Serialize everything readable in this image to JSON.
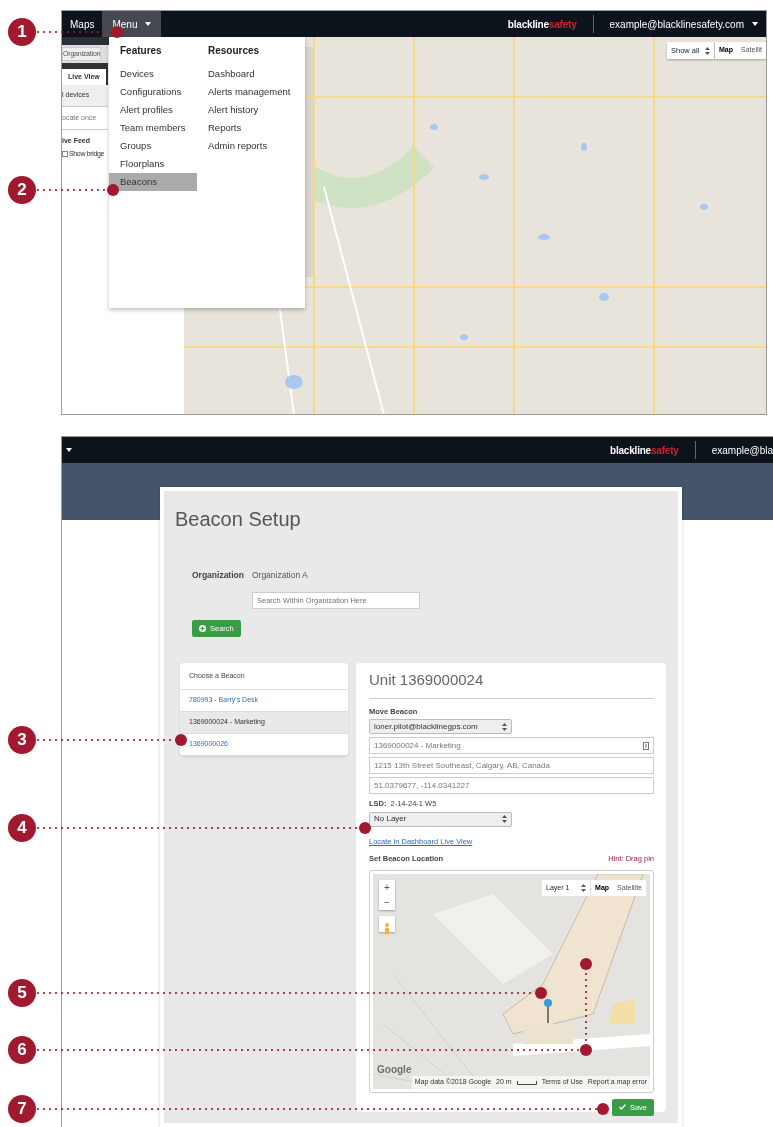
{
  "map_screen": {
    "navbar": {
      "maps_link": "Maps",
      "menu_button": "Menu",
      "logo_dark": "blackline",
      "logo_accent": "safety",
      "user_email": "example@blacklinesafety.com"
    },
    "side_panel": {
      "org_tab": "Organization",
      "tab": {
        "label": "Live View",
        "selected": true
      },
      "devices_row": "l devices",
      "locate_row": "ocate once",
      "feed_heading": "ive Feed",
      "bridge_option": {
        "label": "Show bridge",
        "checked": false
      }
    },
    "menu": {
      "columns": [
        {
          "heading": "Features",
          "items": [
            {
              "label": "Devices",
              "selected": false
            },
            {
              "label": "Configurations",
              "selected": false
            },
            {
              "label": "Alert profiles",
              "selected": false
            },
            {
              "label": "Team members",
              "selected": false
            },
            {
              "label": "Groups",
              "selected": false
            },
            {
              "label": "Floorplans",
              "selected": false
            },
            {
              "label": "Beacons",
              "selected": true
            }
          ]
        },
        {
          "heading": "Resources",
          "items": [
            {
              "label": "Dashboard",
              "selected": false
            },
            {
              "label": "Alerts management",
              "selected": false
            },
            {
              "label": "Alert history",
              "selected": false
            },
            {
              "label": "Reports",
              "selected": false
            },
            {
              "label": "Admin reports",
              "selected": false
            }
          ]
        }
      ]
    },
    "map_controls": {
      "filter_select": "Show all",
      "map_types": [
        {
          "label": "Map",
          "selected": true
        },
        {
          "label": "Satellit",
          "selected": false
        }
      ]
    }
  },
  "beacon_screen": {
    "navbar": {
      "logo_dark": "blackline",
      "logo_accent": "safety",
      "user_email": "example@bla"
    },
    "title": "Beacon Setup",
    "organization_label": "Organization",
    "organization_value": "Organization A",
    "search": {
      "placeholder": "Search Within Organization Here"
    },
    "search_button": "Search",
    "beacon_list": {
      "heading": "Choose a Beacon",
      "items": [
        {
          "label": "780993 - Barry's Desk",
          "selected": false
        },
        {
          "label": "1369000024 - Marketing",
          "selected": true
        },
        {
          "label": "1369000026",
          "selected": false
        }
      ]
    },
    "unit_title": "Unit 1369000024",
    "move_beacon_label": "Move Beacon",
    "owner_select": "loner.pilot@blacklinegps.com",
    "name_field": "1369000024 - Marketing",
    "address_field": "1215 13th Street Southeast, Calgary, AB, Canada",
    "coordinates_field": "51.0379677, -114.0341227",
    "lsd_label": "LSD:",
    "lsd_value": "2-14-24-1 W5",
    "layer_select": "No Layer",
    "locate_link": "Locate in Dashboard Live View",
    "set_location_label": "Set Beacon Location",
    "hint": "Hint: Drag pin",
    "map": {
      "zoom_in": "+",
      "zoom_out": "−",
      "layer_select": "Layer 1",
      "map_types": [
        {
          "label": "Map",
          "selected": true
        },
        {
          "label": "Satellite",
          "selected": false
        }
      ],
      "logo": "Google",
      "attribution": "Map data ©2018 Google",
      "scale": "20 m",
      "terms_link": "Terms of Use",
      "report_link": "Report a map error"
    },
    "save_button": "Save"
  },
  "callouts": [
    {
      "number": "1"
    },
    {
      "number": "2"
    },
    {
      "number": "3"
    },
    {
      "number": "4"
    },
    {
      "number": "5"
    },
    {
      "number": "6"
    },
    {
      "number": "7"
    }
  ]
}
